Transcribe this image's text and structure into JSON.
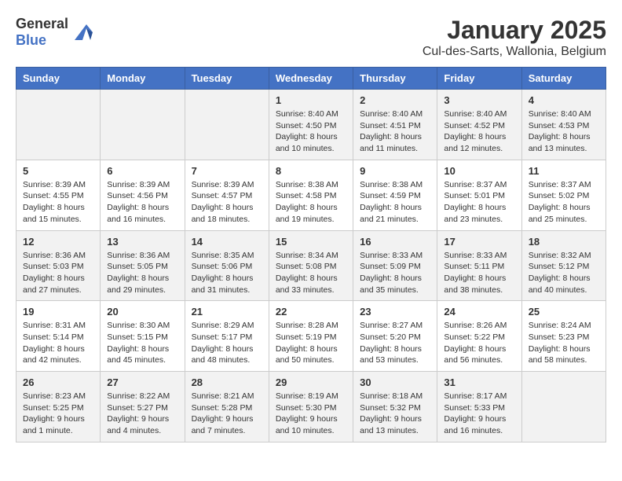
{
  "header": {
    "logo_general": "General",
    "logo_blue": "Blue",
    "month": "January 2025",
    "location": "Cul-des-Sarts, Wallonia, Belgium"
  },
  "days_of_week": [
    "Sunday",
    "Monday",
    "Tuesday",
    "Wednesday",
    "Thursday",
    "Friday",
    "Saturday"
  ],
  "weeks": [
    [
      {
        "day": "",
        "info": ""
      },
      {
        "day": "",
        "info": ""
      },
      {
        "day": "",
        "info": ""
      },
      {
        "day": "1",
        "info": "Sunrise: 8:40 AM\nSunset: 4:50 PM\nDaylight: 8 hours\nand 10 minutes."
      },
      {
        "day": "2",
        "info": "Sunrise: 8:40 AM\nSunset: 4:51 PM\nDaylight: 8 hours\nand 11 minutes."
      },
      {
        "day": "3",
        "info": "Sunrise: 8:40 AM\nSunset: 4:52 PM\nDaylight: 8 hours\nand 12 minutes."
      },
      {
        "day": "4",
        "info": "Sunrise: 8:40 AM\nSunset: 4:53 PM\nDaylight: 8 hours\nand 13 minutes."
      }
    ],
    [
      {
        "day": "5",
        "info": "Sunrise: 8:39 AM\nSunset: 4:55 PM\nDaylight: 8 hours\nand 15 minutes."
      },
      {
        "day": "6",
        "info": "Sunrise: 8:39 AM\nSunset: 4:56 PM\nDaylight: 8 hours\nand 16 minutes."
      },
      {
        "day": "7",
        "info": "Sunrise: 8:39 AM\nSunset: 4:57 PM\nDaylight: 8 hours\nand 18 minutes."
      },
      {
        "day": "8",
        "info": "Sunrise: 8:38 AM\nSunset: 4:58 PM\nDaylight: 8 hours\nand 19 minutes."
      },
      {
        "day": "9",
        "info": "Sunrise: 8:38 AM\nSunset: 4:59 PM\nDaylight: 8 hours\nand 21 minutes."
      },
      {
        "day": "10",
        "info": "Sunrise: 8:37 AM\nSunset: 5:01 PM\nDaylight: 8 hours\nand 23 minutes."
      },
      {
        "day": "11",
        "info": "Sunrise: 8:37 AM\nSunset: 5:02 PM\nDaylight: 8 hours\nand 25 minutes."
      }
    ],
    [
      {
        "day": "12",
        "info": "Sunrise: 8:36 AM\nSunset: 5:03 PM\nDaylight: 8 hours\nand 27 minutes."
      },
      {
        "day": "13",
        "info": "Sunrise: 8:36 AM\nSunset: 5:05 PM\nDaylight: 8 hours\nand 29 minutes."
      },
      {
        "day": "14",
        "info": "Sunrise: 8:35 AM\nSunset: 5:06 PM\nDaylight: 8 hours\nand 31 minutes."
      },
      {
        "day": "15",
        "info": "Sunrise: 8:34 AM\nSunset: 5:08 PM\nDaylight: 8 hours\nand 33 minutes."
      },
      {
        "day": "16",
        "info": "Sunrise: 8:33 AM\nSunset: 5:09 PM\nDaylight: 8 hours\nand 35 minutes."
      },
      {
        "day": "17",
        "info": "Sunrise: 8:33 AM\nSunset: 5:11 PM\nDaylight: 8 hours\nand 38 minutes."
      },
      {
        "day": "18",
        "info": "Sunrise: 8:32 AM\nSunset: 5:12 PM\nDaylight: 8 hours\nand 40 minutes."
      }
    ],
    [
      {
        "day": "19",
        "info": "Sunrise: 8:31 AM\nSunset: 5:14 PM\nDaylight: 8 hours\nand 42 minutes."
      },
      {
        "day": "20",
        "info": "Sunrise: 8:30 AM\nSunset: 5:15 PM\nDaylight: 8 hours\nand 45 minutes."
      },
      {
        "day": "21",
        "info": "Sunrise: 8:29 AM\nSunset: 5:17 PM\nDaylight: 8 hours\nand 48 minutes."
      },
      {
        "day": "22",
        "info": "Sunrise: 8:28 AM\nSunset: 5:19 PM\nDaylight: 8 hours\nand 50 minutes."
      },
      {
        "day": "23",
        "info": "Sunrise: 8:27 AM\nSunset: 5:20 PM\nDaylight: 8 hours\nand 53 minutes."
      },
      {
        "day": "24",
        "info": "Sunrise: 8:26 AM\nSunset: 5:22 PM\nDaylight: 8 hours\nand 56 minutes."
      },
      {
        "day": "25",
        "info": "Sunrise: 8:24 AM\nSunset: 5:23 PM\nDaylight: 8 hours\nand 58 minutes."
      }
    ],
    [
      {
        "day": "26",
        "info": "Sunrise: 8:23 AM\nSunset: 5:25 PM\nDaylight: 9 hours\nand 1 minute."
      },
      {
        "day": "27",
        "info": "Sunrise: 8:22 AM\nSunset: 5:27 PM\nDaylight: 9 hours\nand 4 minutes."
      },
      {
        "day": "28",
        "info": "Sunrise: 8:21 AM\nSunset: 5:28 PM\nDaylight: 9 hours\nand 7 minutes."
      },
      {
        "day": "29",
        "info": "Sunrise: 8:19 AM\nSunset: 5:30 PM\nDaylight: 9 hours\nand 10 minutes."
      },
      {
        "day": "30",
        "info": "Sunrise: 8:18 AM\nSunset: 5:32 PM\nDaylight: 9 hours\nand 13 minutes."
      },
      {
        "day": "31",
        "info": "Sunrise: 8:17 AM\nSunset: 5:33 PM\nDaylight: 9 hours\nand 16 minutes."
      },
      {
        "day": "",
        "info": ""
      }
    ]
  ]
}
